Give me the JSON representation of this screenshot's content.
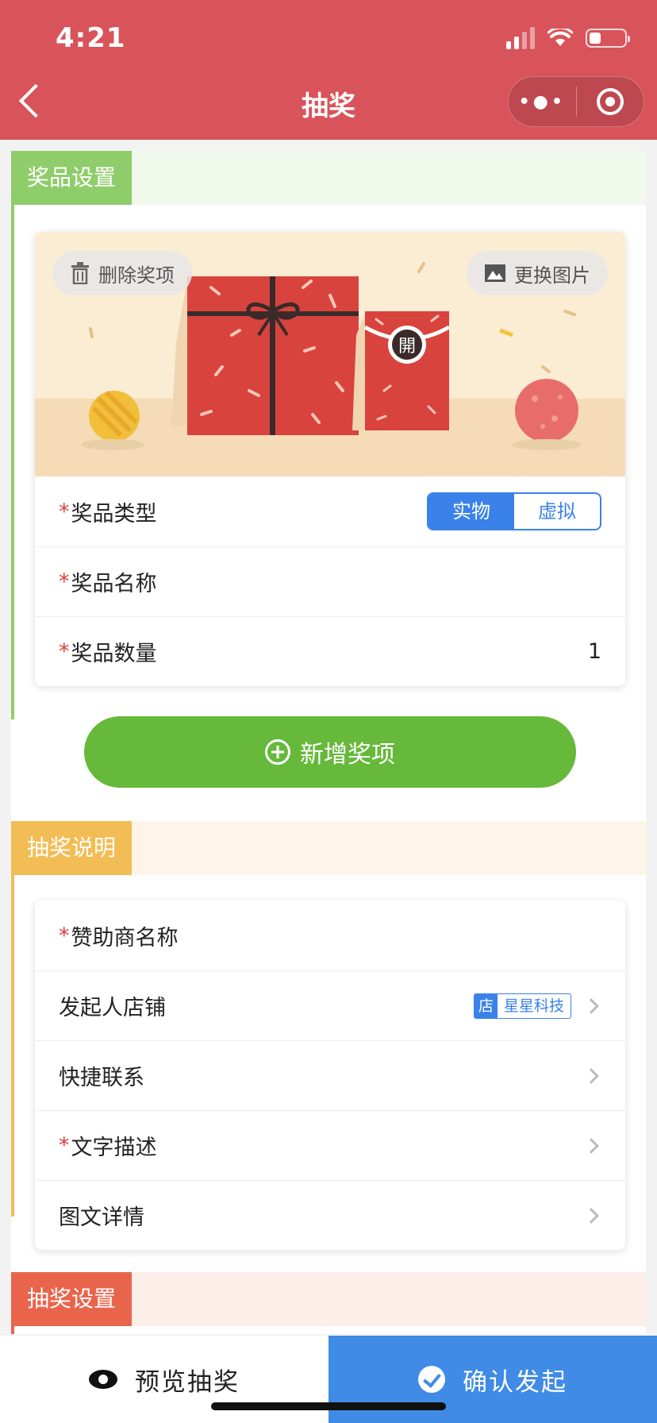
{
  "status_bar": {
    "time": "4:21"
  },
  "nav": {
    "title": "抽奖",
    "more_icon": "more-dots-icon",
    "close_icon": "target-icon",
    "back_icon": "chevron-left-icon"
  },
  "colors": {
    "header": "#d9535a",
    "prize_tab": "#8fcd6a",
    "desc_tab": "#f2bd55",
    "settings_tab": "#e8654c",
    "primary_blue": "#3a82ea",
    "add_green": "#66b93a"
  },
  "prize_section": {
    "tab": "奖品设置",
    "banner": {
      "delete_label": "删除奖项",
      "change_image_label": "更换图片",
      "envelope_char": "開"
    },
    "type_row": {
      "label": "奖品类型",
      "options": [
        "实物",
        "虚拟"
      ],
      "selected": "实物"
    },
    "name_row": {
      "label": "奖品名称",
      "value": ""
    },
    "quantity_row": {
      "label": "奖品数量",
      "value": "1"
    },
    "add_button": "新增奖项"
  },
  "desc_section": {
    "tab": "抽奖说明",
    "sponsor_row": {
      "label": "赞助商名称"
    },
    "shop_row": {
      "label": "发起人店铺",
      "badge_key": "店",
      "badge_value": "星星科技"
    },
    "contact_row": {
      "label": "快捷联系"
    },
    "text_row": {
      "label": "文字描述"
    },
    "detail_row": {
      "label": "图文详情"
    }
  },
  "settings_section": {
    "tab": "抽奖设置"
  },
  "bottom_bar": {
    "preview": "预览抽奖",
    "confirm": "确认发起"
  }
}
